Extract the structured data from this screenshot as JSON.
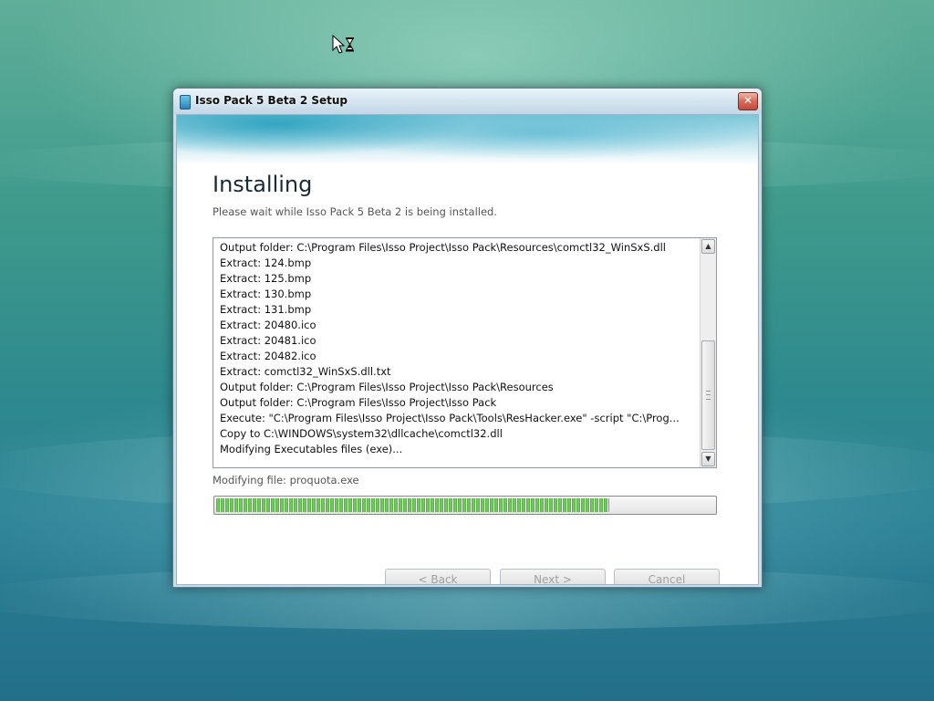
{
  "window": {
    "title": "Isso Pack 5 Beta 2 Setup",
    "close_symbol": "✕"
  },
  "page": {
    "heading": "Installing",
    "subheading": "Please wait while Isso Pack 5 Beta 2 is being installed."
  },
  "log": {
    "lines": [
      "Output folder: C:\\Program Files\\Isso Project\\Isso Pack\\Resources\\comctl32_WinSxS.dll",
      "Extract: 124.bmp",
      "Extract: 125.bmp",
      "Extract: 130.bmp",
      "Extract: 131.bmp",
      "Extract: 20480.ico",
      "Extract: 20481.ico",
      "Extract: 20482.ico",
      "Extract: comctl32_WinSxS.dll.txt",
      "Output folder: C:\\Program Files\\Isso Project\\Isso Pack\\Resources",
      "Output folder: C:\\Program Files\\Isso Project\\Isso Pack",
      "Execute: \"C:\\Program Files\\Isso Project\\Isso Pack\\Tools\\ResHacker.exe\" -script \"C:\\Prog...",
      "Copy to C:\\WINDOWS\\system32\\dllcache\\comctl32.dll",
      "Modifying Executables files (exe)..."
    ],
    "scroll_up_symbol": "▲",
    "scroll_down_symbol": "▼"
  },
  "status": {
    "text": "Modifying file: proquota.exe",
    "progress_fraction": 0.79
  },
  "buttons": {
    "back": "< Back",
    "next": "Next >",
    "cancel": "Cancel"
  },
  "colors": {
    "progress_green": "#4caf3a",
    "desktop_teal": "#2f8a8e"
  },
  "icons": {
    "cursor": "busy-cursor-icon",
    "app": "setup-app-icon",
    "close": "close-icon"
  }
}
